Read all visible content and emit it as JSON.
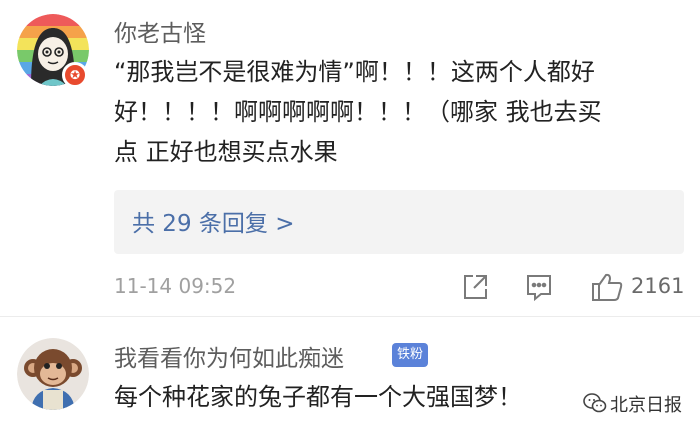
{
  "comments": [
    {
      "username": "你老古怪",
      "badge_icon": "star-badge-icon",
      "text_lines": [
        "“那我岂不是很难为情”啊！！！这两个人都好",
        "好！！！！啊啊啊啊啊！！！（哪家 我也去买",
        "点 正好也想买点水果"
      ],
      "replies_label": "共 29 条回复 >",
      "timestamp": "11-14 09:52",
      "actions": {
        "share_icon": "share-icon",
        "comment_icon": "comment-icon",
        "like_icon": "thumbs-up-icon"
      },
      "like_count": "2161"
    },
    {
      "username": "我看看你为何如此痴迷",
      "fan_badge": "铁粉",
      "text_lines": [
        "每个种花家的兔子都有一个大强国梦！"
      ]
    }
  ],
  "watermark": {
    "icon": "wechat-icon",
    "text": "北京日报"
  }
}
